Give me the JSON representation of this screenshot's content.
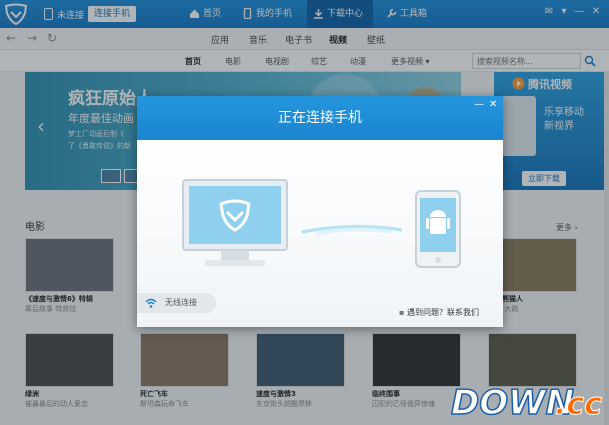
{
  "titlebar": {
    "status": "未连接",
    "connect_button": "连接手机",
    "tabs": [
      {
        "label": "首页"
      },
      {
        "label": "我的手机"
      },
      {
        "label": "下载中心"
      },
      {
        "label": "工具箱"
      }
    ]
  },
  "toolbar": {
    "categories": [
      "应用",
      "音乐",
      "电子书",
      "视频",
      "壁纸"
    ],
    "active_category": "视频"
  },
  "subtabs": {
    "items": [
      "首页",
      "电影",
      "电视剧",
      "综艺",
      "动漫",
      "更多视频"
    ],
    "search_placeholder": "搜索视频名称..."
  },
  "banner": {
    "title": "疯狂原始人",
    "subtitle": "年度最佳动画",
    "desc_line1": "梦工厂动画巨制《",
    "desc_line2": "了《勇敢传说》的新"
  },
  "side_ad": {
    "brand": "腾讯视频",
    "slogan_line1": "乐享移动",
    "slogan_line2": "新视界",
    "download": "立即下载"
  },
  "movies": {
    "section_title": "电影",
    "more": "更多",
    "row1": [
      {
        "title": "《速度与激情6》特辑",
        "sub": "幕后故事 特效炫"
      },
      {
        "title": "",
        "sub": ""
      },
      {
        "title": "",
        "sub": ""
      },
      {
        "title": "",
        "sub": ""
      },
      {
        "title": "功夫熊猫人",
        "sub": "东方 大碗"
      }
    ],
    "row2": [
      {
        "title": "绿洲",
        "sub": "催暴暴后的动人爱恋"
      },
      {
        "title": "死亡飞车",
        "sub": "斯坦森玩命飞车"
      },
      {
        "title": "速度与激情3",
        "sub": "东京街头超酷票移"
      },
      {
        "title": "临终围事",
        "sub": "囚犯的乙怪诡异惊魂"
      },
      {
        "title": "",
        "sub": ""
      }
    ]
  },
  "dialog": {
    "title": "正在连接手机",
    "wifi_label": "无线连接",
    "help_text": "遇到问题？联系我们"
  },
  "watermark": {
    "text": "DOWN.cc"
  },
  "colors": {
    "titlebar_blue": "#1479c8",
    "active_tab": "#0d62a8",
    "dialog_header": "#2596de",
    "monitor_screen": "#8fd0ef"
  }
}
